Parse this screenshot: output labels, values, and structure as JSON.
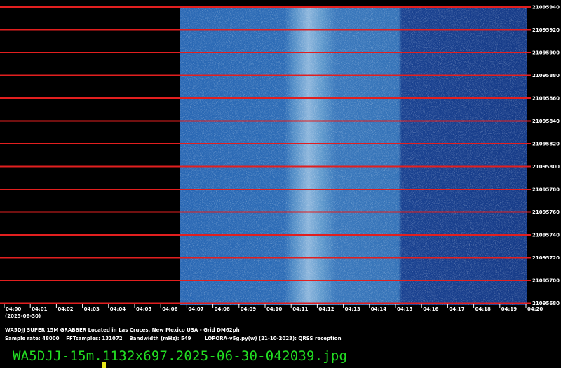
{
  "frequency_axis": {
    "labels": [
      "21095940",
      "21095920",
      "21095900",
      "21095880",
      "21095860",
      "21095840",
      "21095820",
      "21095800",
      "21095780",
      "21095760",
      "21095740",
      "21095720",
      "21095700",
      "21095680"
    ]
  },
  "time_axis": {
    "labels": [
      "04:00",
      "04:01",
      "04:02",
      "04:03",
      "04:04",
      "04:05",
      "04:06",
      "04:07",
      "04:08",
      "04:09",
      "04:10",
      "04:11",
      "04:12",
      "04:13",
      "04:14",
      "04:15",
      "04:16",
      "04:17",
      "04:18",
      "04:19",
      "04:20"
    ],
    "date": "(2025-06-30)"
  },
  "info": {
    "line1": "WA5DJJ SUPER 15M GRABBER Located in Las Cruces, New Mexico USA - Grid DM62ph",
    "line2": "Sample rate: 48000    FFTsamples: 131072    Bandwidth (mHz): 549        LOPORA-v5g.py(w) (21-10-2023): QRSS reception"
  },
  "caption": "WA5DJJ-15m.1132x697.2025-06-30-042039.jpg",
  "colors": {
    "gridline": "#e21f1f",
    "caption": "#22dd22",
    "cursor": "#e6e61a",
    "waterfall_base": "#1f5aa8",
    "waterfall_bright": "#cfe0f0",
    "waterfall_dark": "#16398a"
  }
}
